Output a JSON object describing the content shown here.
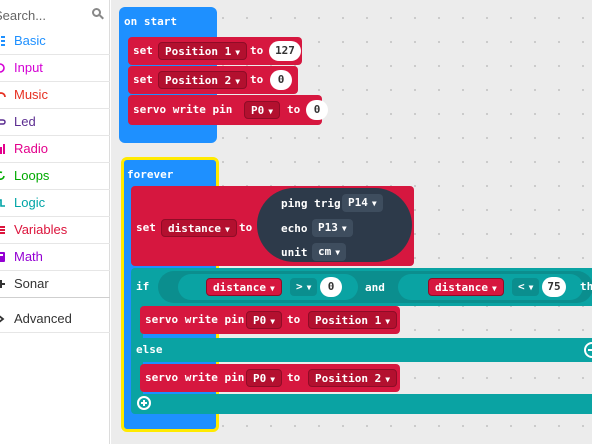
{
  "sidebar": {
    "search": {
      "placeholder": "Search..."
    },
    "categories": [
      {
        "label": "Basic",
        "color": "#1e90ff",
        "icon": "grid-icon"
      },
      {
        "label": "Input",
        "color": "#d400d4",
        "icon": "target-icon"
      },
      {
        "label": "Music",
        "color": "#e63022",
        "icon": "headphones-icon"
      },
      {
        "label": "Led",
        "color": "#5c2d91",
        "icon": "toggle-icon"
      },
      {
        "label": "Radio",
        "color": "#e3008c",
        "icon": "bars-icon"
      },
      {
        "label": "Loops",
        "color": "#00aa00",
        "icon": "refresh-icon"
      },
      {
        "label": "Logic",
        "color": "#00a4a6",
        "icon": "shuffle-icon"
      },
      {
        "label": "Variables",
        "color": "#dc143c",
        "icon": "list-icon"
      },
      {
        "label": "Math",
        "color": "#9400d3",
        "icon": "calculator-icon"
      },
      {
        "label": "Sonar",
        "color": "#333333",
        "icon": "plus-icon"
      }
    ],
    "advanced": {
      "label": "Advanced",
      "icon": "chevron-right-icon"
    }
  },
  "on_start": {
    "label": "on start",
    "row1": {
      "set": "set",
      "var": "Position 1",
      "to": "to",
      "value": "127"
    },
    "row2": {
      "set": "set",
      "var": "Position 2",
      "to": "to",
      "value": "0"
    },
    "row3": {
      "label": "servo write pin",
      "pin": "P0",
      "to": "to",
      "value": "0"
    }
  },
  "forever": {
    "label": "forever",
    "set_row": {
      "set": "set",
      "var": "distance",
      "to": "to"
    },
    "ping": {
      "label": "ping trig",
      "trig": "P14",
      "echo_label": "echo",
      "echo": "P13",
      "unit_label": "unit",
      "unit": "cm"
    },
    "if_row": {
      "if": "if",
      "left_var": "distance",
      "left_op": ">",
      "left_val": "0",
      "and": "and",
      "right_var": "distance",
      "right_op": "<",
      "right_val": "75",
      "then": "then"
    },
    "then_row": {
      "label": "servo write pin",
      "pin": "P0",
      "to": "to",
      "var": "Position 1"
    },
    "else": "else",
    "else_row": {
      "label": "servo write pin",
      "pin": "P0",
      "to": "to",
      "var": "Position 2"
    }
  }
}
